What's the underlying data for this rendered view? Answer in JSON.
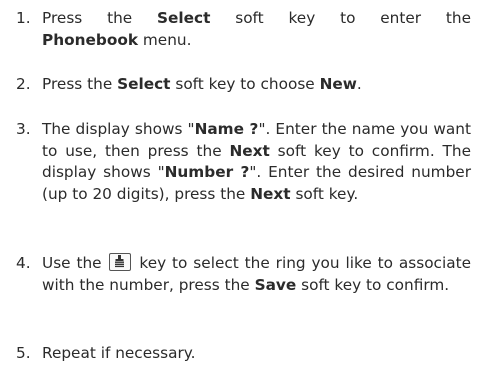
{
  "steps": [
    {
      "number": "1.",
      "segments": [
        {
          "text": "Press the "
        },
        {
          "text": "Select",
          "bold": true
        },
        {
          "text": " soft key to enter the "
        },
        {
          "text": "Phonebook",
          "bold": true
        },
        {
          "text": " menu."
        }
      ]
    },
    {
      "number": "2.",
      "segments": [
        {
          "text": "Press the "
        },
        {
          "text": "Select",
          "bold": true
        },
        {
          "text": " soft key to choose "
        },
        {
          "text": "New",
          "bold": true
        },
        {
          "text": "."
        }
      ]
    },
    {
      "number": "3.",
      "segments": [
        {
          "text": "The display shows \""
        },
        {
          "text": "Name ?",
          "bold": true
        },
        {
          "text": "\". Enter the name you want to use, then press the "
        },
        {
          "text": "Next",
          "bold": true
        },
        {
          "text": " soft key to confirm. The display shows \""
        },
        {
          "text": "Number ?",
          "bold": true
        },
        {
          "text": "\". Enter the desired number (up to 20 digits), press the "
        },
        {
          "text": "Next",
          "bold": true
        },
        {
          "text": " soft key."
        }
      ]
    },
    {
      "number": "4.",
      "segments": [
        {
          "text": "Use the "
        },
        {
          "icon": "phonebook-key-icon"
        },
        {
          "text": " key to select the ring you like to associate with the number, press the "
        },
        {
          "text": "Save",
          "bold": true
        },
        {
          "text": " soft key to confirm."
        }
      ]
    },
    {
      "number": "5.",
      "segments": [
        {
          "text": "Repeat if necessary."
        }
      ]
    }
  ]
}
